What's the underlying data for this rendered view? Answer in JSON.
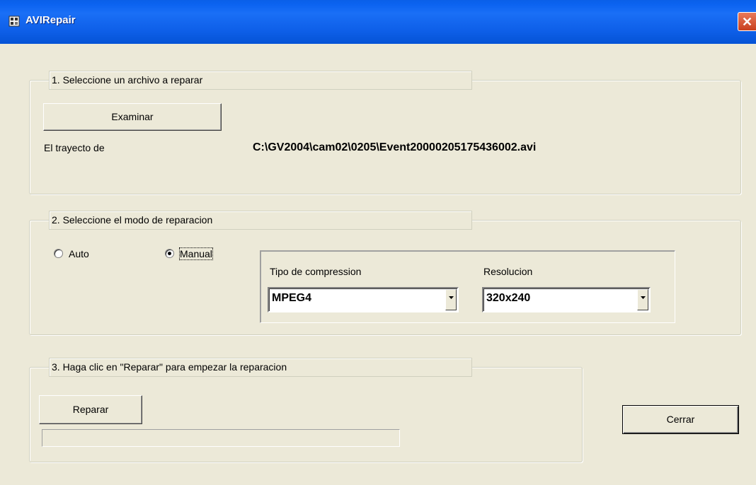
{
  "window": {
    "title": "AVIRepair",
    "close_glyph": "✕",
    "icon": "app-icon"
  },
  "section1": {
    "legend": "1. Seleccione un archivo a reparar",
    "browse_button": "Examinar",
    "path_label": "El trayecto de",
    "path_value": "C:\\GV2004\\cam02\\0205\\Event20000205175436002.avi"
  },
  "section2": {
    "legend": "2. Seleccione el modo de reparacion",
    "modes": [
      {
        "label": "Auto",
        "selected": false
      },
      {
        "label": "Manual",
        "selected": true
      }
    ],
    "compression": {
      "label": "Tipo de compression",
      "value": "MPEG4"
    },
    "resolution": {
      "label": "Resolucion",
      "value": "320x240"
    }
  },
  "section3": {
    "legend": "3. Haga clic en \"Reparar\" para empezar la reparacion",
    "repair_button": "Reparar",
    "progress": 0
  },
  "footer": {
    "close_button": "Cerrar"
  },
  "colors": {
    "titlebar": "#0b63f0",
    "dialog_bg": "#ece9d8",
    "close_button": "#c8401f"
  }
}
